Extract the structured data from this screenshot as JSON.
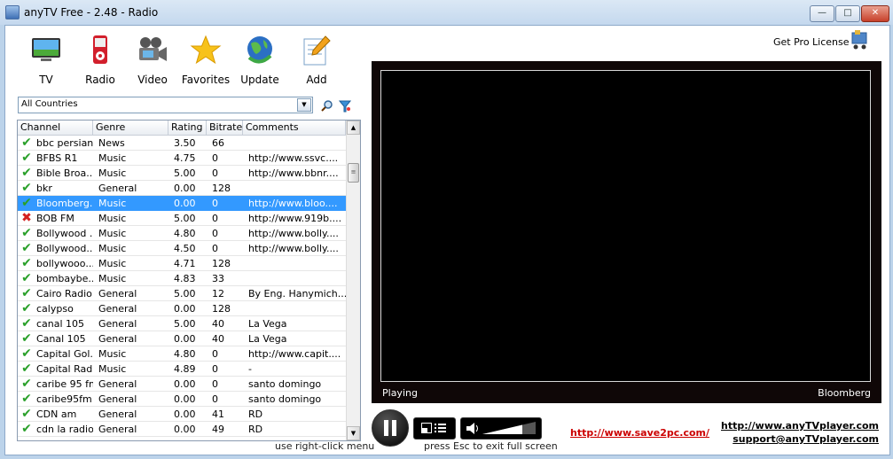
{
  "window": {
    "title": "anyTV Free - 2.48 - Radio",
    "minimize": "—",
    "maximize": "□",
    "close": "✕"
  },
  "toolbar": [
    {
      "label": "TV",
      "icon": "tv-icon"
    },
    {
      "label": "Radio",
      "icon": "radio-icon"
    },
    {
      "label": "Video",
      "icon": "video-camera-icon"
    },
    {
      "label": "Favorites",
      "icon": "star-icon"
    },
    {
      "label": "Update",
      "icon": "globe-icon"
    },
    {
      "label": "Add",
      "icon": "document-pencil-icon"
    }
  ],
  "filter": {
    "selected": "All Countries"
  },
  "pro": {
    "label": "Get Pro License"
  },
  "table": {
    "headers": [
      "Channel",
      "Genre",
      "Rating",
      "Bitrate",
      "Comments"
    ],
    "rows": [
      {
        "status": "ok",
        "channel": "bbc persian",
        "genre": "News",
        "rating": "3.50",
        "bitrate": "66",
        "comments": ""
      },
      {
        "status": "ok",
        "channel": "BFBS R1",
        "genre": "Music",
        "rating": "4.75",
        "bitrate": "0",
        "comments": "http://www.ssvc...."
      },
      {
        "status": "ok",
        "channel": "Bible Broa...",
        "genre": "Music",
        "rating": "5.00",
        "bitrate": "0",
        "comments": "http://www.bbnr...."
      },
      {
        "status": "ok",
        "channel": "bkr",
        "genre": "General",
        "rating": "0.00",
        "bitrate": "128",
        "comments": ""
      },
      {
        "status": "ok",
        "channel": "Bloomberg...",
        "genre": "Music",
        "rating": "0.00",
        "bitrate": "0",
        "comments": "http://www.bloo....",
        "selected": true
      },
      {
        "status": "bad",
        "channel": "BOB FM",
        "genre": "Music",
        "rating": "5.00",
        "bitrate": "0",
        "comments": "http://www.919b...."
      },
      {
        "status": "ok",
        "channel": "Bollywood ...",
        "genre": "Music",
        "rating": "4.80",
        "bitrate": "0",
        "comments": "http://www.bolly...."
      },
      {
        "status": "ok",
        "channel": "Bollywood...",
        "genre": "Music",
        "rating": "4.50",
        "bitrate": "0",
        "comments": "http://www.bolly...."
      },
      {
        "status": "ok",
        "channel": "bollywooo...",
        "genre": "Music",
        "rating": "4.71",
        "bitrate": "128",
        "comments": ""
      },
      {
        "status": "ok",
        "channel": "bombaybe...",
        "genre": "Music",
        "rating": "4.83",
        "bitrate": "33",
        "comments": ""
      },
      {
        "status": "ok",
        "channel": "Cairo Radio",
        "genre": "General",
        "rating": "5.00",
        "bitrate": "12",
        "comments": "By Eng. Hanymich...."
      },
      {
        "status": "ok",
        "channel": "calypso",
        "genre": "General",
        "rating": "0.00",
        "bitrate": "128",
        "comments": ""
      },
      {
        "status": "ok",
        "channel": "canal 105",
        "genre": "General",
        "rating": "5.00",
        "bitrate": "40",
        "comments": "La Vega"
      },
      {
        "status": "ok",
        "channel": "Canal 105",
        "genre": "General",
        "rating": "0.00",
        "bitrate": "40",
        "comments": "La Vega"
      },
      {
        "status": "ok",
        "channel": "Capital Gol...",
        "genre": "Music",
        "rating": "4.80",
        "bitrate": "0",
        "comments": "http://www.capit...."
      },
      {
        "status": "ok",
        "channel": "Capital Radio",
        "genre": "Music",
        "rating": "4.89",
        "bitrate": "0",
        "comments": "-"
      },
      {
        "status": "ok",
        "channel": "caribe 95 fm",
        "genre": "General",
        "rating": "0.00",
        "bitrate": "0",
        "comments": "santo domingo"
      },
      {
        "status": "ok",
        "channel": "caribe95fm",
        "genre": "General",
        "rating": "0.00",
        "bitrate": "0",
        "comments": "santo domingo"
      },
      {
        "status": "ok",
        "channel": "CDN am",
        "genre": "General",
        "rating": "0.00",
        "bitrate": "41",
        "comments": "RD"
      },
      {
        "status": "ok",
        "channel": "cdn la radio",
        "genre": "General",
        "rating": "0.00",
        "bitrate": "49",
        "comments": "RD"
      }
    ]
  },
  "list_hint": "use right-click menu",
  "player": {
    "status": "Playing",
    "station": "Bloomberg",
    "volume": 0.75
  },
  "esc_hint": "press Esc to exit full screen",
  "links": {
    "save2pc": "http://www.save2pc.com/",
    "site": "http://www.anyTVplayer.com",
    "support": "support@anyTVplayer.com"
  },
  "colors": {
    "selection": "#3399ff",
    "player_bg": "#0f0707",
    "link_red": "#cc0000"
  }
}
